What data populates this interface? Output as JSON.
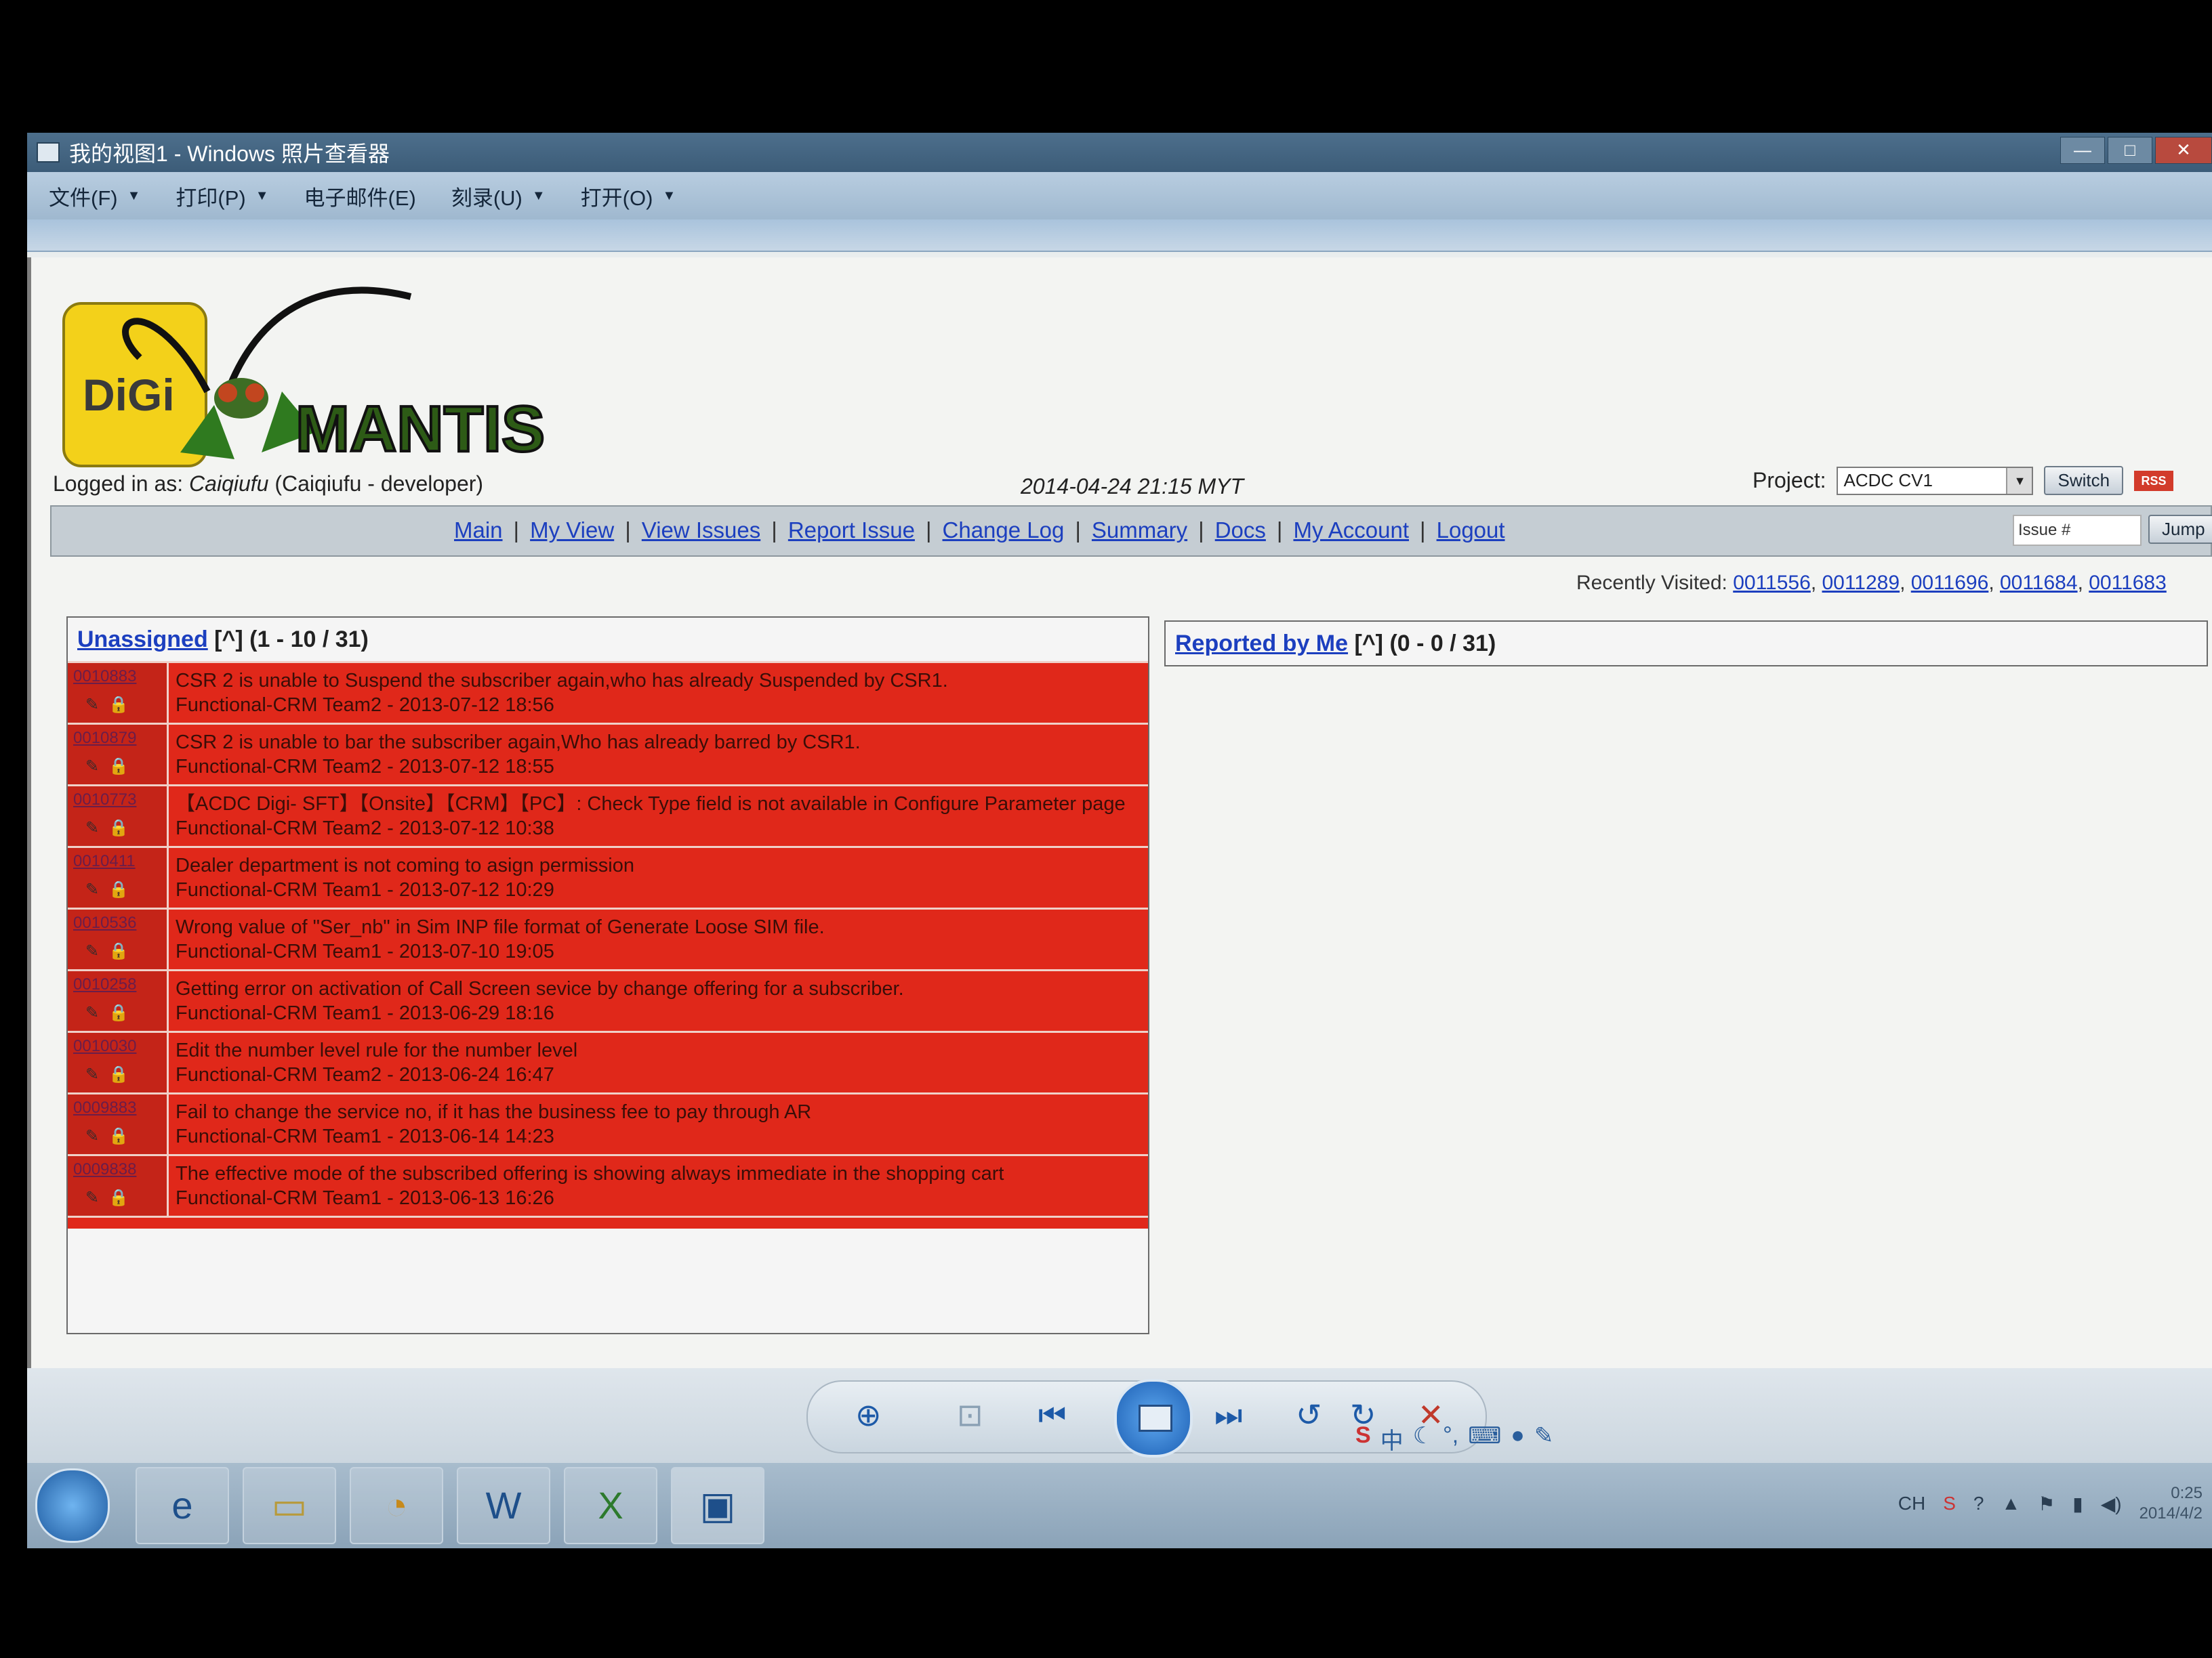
{
  "window": {
    "title": "我的视图1 - Windows 照片查看器",
    "controls": [
      "—",
      "□",
      "✕"
    ]
  },
  "menubar": [
    {
      "label": "文件(F)",
      "has_arrow": true
    },
    {
      "label": "打印(P)",
      "has_arrow": true
    },
    {
      "label": "电子邮件(E)",
      "has_arrow": false
    },
    {
      "label": "刻录(U)",
      "has_arrow": true
    },
    {
      "label": "打开(O)",
      "has_arrow": true
    }
  ],
  "header": {
    "logo_text": "DiGi",
    "logo_wordmark": "MANTIS",
    "logged_in_prefix": "Logged in as:",
    "username": "Caiqiufu",
    "user_detail": "(Caiqiufu - developer)",
    "datetime": "2014-04-24 21:15 MYT",
    "project_label": "Project:",
    "project_value": "ACDC CV1",
    "switch_label": "Switch",
    "rss_label": "RSS"
  },
  "nav": {
    "links": [
      "Main",
      "My View",
      "View Issues",
      "Report Issue",
      "Change Log",
      "Summary",
      "Docs",
      "My Account",
      "Logout"
    ],
    "separator": "|",
    "issue_placeholder": "Issue #",
    "jump_label": "Jump"
  },
  "recently_visited": {
    "label": "Recently Visited:",
    "ids": [
      "0011556",
      "0011289",
      "0011696",
      "0011684",
      "0011683"
    ]
  },
  "unassigned": {
    "title": "Unassigned",
    "toggle": "[^]",
    "range": "(1 - 10 / 31)",
    "issues": [
      {
        "id": "0010883",
        "summary": "CSR 2 is unable to Suspend the subscriber again,who has already Suspended by CSR1.",
        "meta": "Functional-CRM Team2 - 2013-07-12 18:56"
      },
      {
        "id": "0010879",
        "summary": "CSR 2 is unable to bar the subscriber again,Who has already barred by CSR1.",
        "meta": "Functional-CRM Team2 - 2013-07-12 18:55"
      },
      {
        "id": "0010773",
        "summary": "【ACDC Digi- SFT】【Onsite】【CRM】【PC】: Check Type field is not available in Configure Parameter page",
        "meta": "Functional-CRM Team2 - 2013-07-12 10:38"
      },
      {
        "id": "0010411",
        "summary": "Dealer department is not coming to asign permission",
        "meta": "Functional-CRM Team1 - 2013-07-12 10:29"
      },
      {
        "id": "0010536",
        "summary": "Wrong value of \"Ser_nb\" in Sim INP file format of Generate Loose SIM file.",
        "meta": "Functional-CRM Team1 - 2013-07-10 19:05"
      },
      {
        "id": "0010258",
        "summary": "Getting error on activation of Call Screen sevice by change offering for a subscriber.",
        "meta": "Functional-CRM Team1 - 2013-06-29 18:16"
      },
      {
        "id": "0010030",
        "summary": "Edit the number level rule for the number level",
        "meta": "Functional-CRM Team2 - 2013-06-24 16:47"
      },
      {
        "id": "0009883",
        "summary": "Fail to change the service no, if it has the business fee to pay through AR",
        "meta": "Functional-CRM Team1 - 2013-06-14 14:23"
      },
      {
        "id": "0009838",
        "summary": "The effective mode of the subscribed offering is showing always immediate in the shopping cart",
        "meta": "Functional-CRM Team1 - 2013-06-13 16:26"
      }
    ]
  },
  "reported": {
    "title": "Reported by Me",
    "toggle": "[^]",
    "range": "(0 - 0 / 31)"
  },
  "viewer_controls": {
    "zoom": "⊕",
    "fit": "⊡",
    "prev": "⏮",
    "next": "⏭",
    "rotate_ccw": "↺",
    "rotate_cw": "↻",
    "delete": "✕"
  },
  "ime": {
    "logo": "S",
    "mode": "中"
  },
  "taskbar": {
    "apps": [
      "internet-explorer-icon",
      "explorer-icon",
      "outlook-icon",
      "word-icon",
      "excel-icon",
      "photo-viewer-icon"
    ],
    "tray_lang": "CH",
    "time": "0:25",
    "date": "2014/4/2"
  },
  "colors": {
    "row_bg": "#e0281a",
    "link": "#1c3fbf"
  }
}
